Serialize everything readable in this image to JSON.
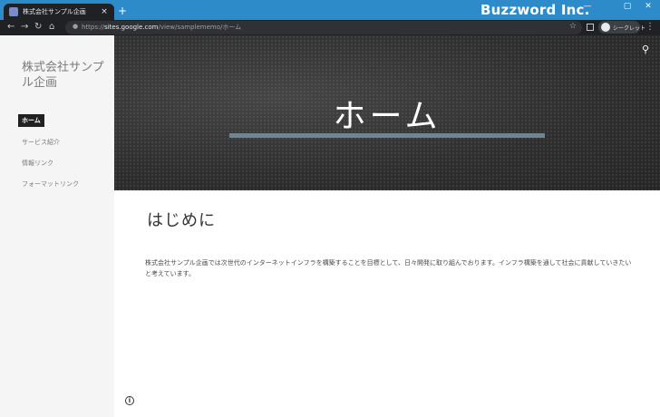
{
  "browser": {
    "tab_title": "株式会社サンプル企画",
    "tab_close": "×",
    "new_tab": "+",
    "brand": "Buzzword Inc.",
    "window_controls": [
      "—",
      "▢",
      "✕"
    ],
    "nav": {
      "back": "←",
      "forward": "→",
      "reload": "↻",
      "home": "⌂"
    },
    "url_prefix": "https://",
    "url_host": "sites.google.com",
    "url_path": "/view/samplememo/ホーム",
    "incognito_label": "シークレット",
    "menu": "⋮"
  },
  "site": {
    "title": "株式会社サンプル企画",
    "nav_items": [
      {
        "label": "ホーム",
        "active": true
      },
      {
        "label": "サービス紹介",
        "active": false
      },
      {
        "label": "情報リンク",
        "active": false
      },
      {
        "label": "フォーマットリンク",
        "active": false
      }
    ]
  },
  "hero": {
    "title": "ホーム",
    "bar_color": "#6a8799"
  },
  "content": {
    "heading": "はじめに",
    "paragraph": "株式会社サンプル企画では次世代のインターネットインフラを構築することを目標として、日々開発に取り組んでおります。インフラ構築を通して社会に貢献していきたいと考えています。"
  },
  "icons": {
    "search": "search-icon",
    "info": "info-icon",
    "info_glyph": "i"
  }
}
